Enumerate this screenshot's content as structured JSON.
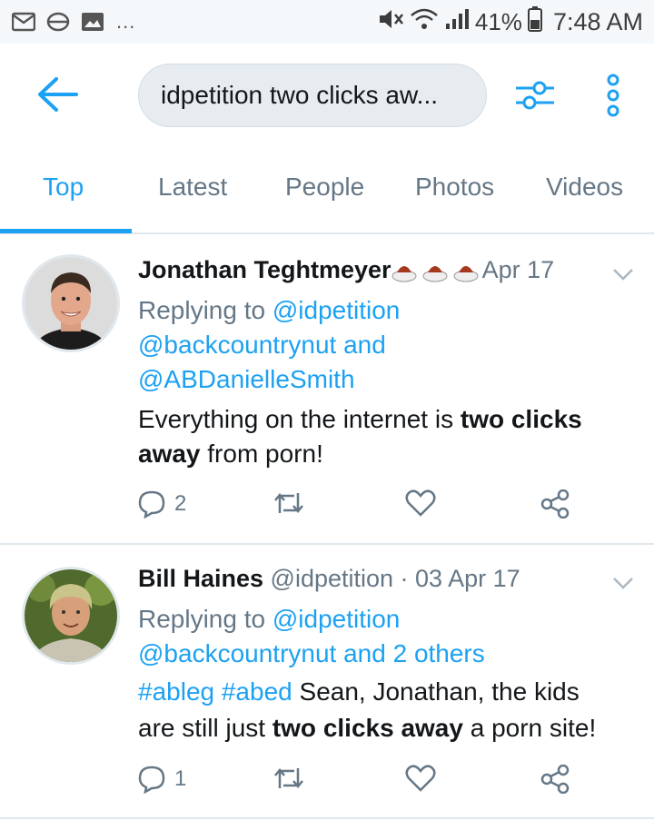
{
  "status_bar": {
    "dots": "...",
    "battery_percent": "41%",
    "time": "7:48 AM"
  },
  "header": {
    "search_query": "idpetition two clicks aw..."
  },
  "tabs": [
    {
      "label": "Top",
      "active": true
    },
    {
      "label": "Latest",
      "active": false
    },
    {
      "label": "People",
      "active": false
    },
    {
      "label": "Photos",
      "active": false
    },
    {
      "label": "Videos",
      "active": false
    }
  ],
  "tweets": [
    {
      "name": "Jonathan Teghtmeyer",
      "date": "Apr 17",
      "replying_prefix": "Replying to ",
      "replying_handle": "@idpetition",
      "reply_line2": "@backcountrynut and",
      "reply_line3": "@ABDanielleSmith",
      "text_l1_a": "Everything on the internet is ",
      "text_l1_b": "two clicks",
      "text_l2_a": "away",
      "text_l2_b": " from porn!",
      "reply_count": "2"
    },
    {
      "name": "Bill Haines",
      "handle": " @idpetition",
      "date": " · 03 Apr 17",
      "replying_prefix": "Replying to ",
      "replying_handle": "@idpetition",
      "reply_line2": "@backcountrynut and 2 others",
      "hashtags": "#ableg #abed",
      "text_l1_rest": " Sean, Jonathan, the kids",
      "text_l2_a": "are still just ",
      "text_l2_b": "two clicks away",
      "text_l2_c": " a porn site!",
      "reply_count": "1"
    }
  ],
  "colors": {
    "accent": "#1da1f2",
    "muted": "#657786",
    "text": "#14171a",
    "divider": "#e1e8ed"
  }
}
